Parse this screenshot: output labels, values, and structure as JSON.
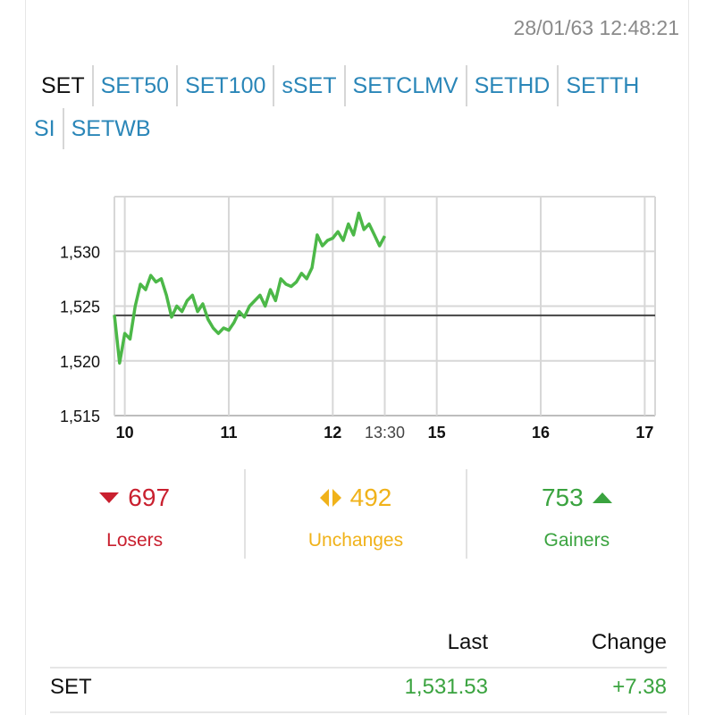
{
  "header": {
    "timestamp": "28/01/63 12:48:21"
  },
  "tabs": {
    "row1": [
      {
        "label": "SET",
        "active": true
      },
      {
        "label": "SET50",
        "active": false
      },
      {
        "label": "SET100",
        "active": false
      },
      {
        "label": "sSET",
        "active": false
      },
      {
        "label": "SETCLMV",
        "active": false
      },
      {
        "label": "SETHD",
        "active": false
      },
      {
        "label": "SETTH",
        "active": false
      }
    ],
    "row2": [
      {
        "label": "SI",
        "active": false
      },
      {
        "label": "SETWB",
        "active": false
      }
    ]
  },
  "chart_data": {
    "type": "line",
    "title": "",
    "xlabel": "",
    "ylabel": "",
    "ylim": [
      1515,
      1535
    ],
    "yticks": [
      "1,515",
      "1,520",
      "1,525",
      "1,530"
    ],
    "ytick_values": [
      1515,
      1520,
      1525,
      1530
    ],
    "xticks": [
      "10",
      "11",
      "12",
      "13:30",
      "15",
      "16",
      "17"
    ],
    "xtick_values": [
      10,
      11,
      12,
      12.5,
      13,
      14,
      15
    ],
    "xlim": [
      9.9,
      15.1
    ],
    "reference_line": 1524.15,
    "grid": true,
    "series": [
      {
        "x": [
          9.9,
          9.95,
          10.0,
          10.05,
          10.1,
          10.15,
          10.2,
          10.25,
          10.3,
          10.35,
          10.4,
          10.45,
          10.5,
          10.55,
          10.6,
          10.65,
          10.7,
          10.75,
          10.8,
          10.85,
          10.9,
          10.95,
          11.0,
          11.05,
          11.1,
          11.15,
          11.2,
          11.25,
          11.3,
          11.35,
          11.4,
          11.45,
          11.5,
          11.55,
          11.6,
          11.65,
          11.7,
          11.75,
          11.8,
          11.85,
          11.9,
          11.95,
          12.0,
          12.05,
          12.1,
          12.15,
          12.2,
          12.25,
          12.3,
          12.35,
          12.4,
          12.45,
          12.5
        ],
        "values": [
          1524.2,
          1519.8,
          1522.5,
          1522.0,
          1525.0,
          1527.0,
          1526.5,
          1527.8,
          1527.2,
          1527.5,
          1526.0,
          1524.0,
          1525.0,
          1524.5,
          1525.5,
          1526.0,
          1524.5,
          1525.2,
          1523.8,
          1523.0,
          1522.5,
          1523.0,
          1522.8,
          1523.5,
          1524.5,
          1524.0,
          1525.0,
          1525.5,
          1526.0,
          1525.0,
          1526.5,
          1525.5,
          1527.5,
          1527.0,
          1526.8,
          1527.2,
          1528.0,
          1527.5,
          1528.5,
          1531.5,
          1530.5,
          1531.0,
          1531.2,
          1531.8,
          1531.0,
          1532.5,
          1531.5,
          1533.5,
          1532.0,
          1532.5,
          1531.5,
          1530.5,
          1531.4
        ],
        "color": "#4cb848"
      }
    ]
  },
  "stats": {
    "losers": {
      "count": "697",
      "label": "Losers"
    },
    "unchanges": {
      "count": "492",
      "label": "Unchanges"
    },
    "gainers": {
      "count": "753",
      "label": "Gainers"
    }
  },
  "table": {
    "headers": {
      "last": "Last",
      "change": "Change"
    },
    "rows": [
      {
        "name": "SET",
        "last": "1,531.53",
        "change": "+7.38"
      }
    ]
  }
}
